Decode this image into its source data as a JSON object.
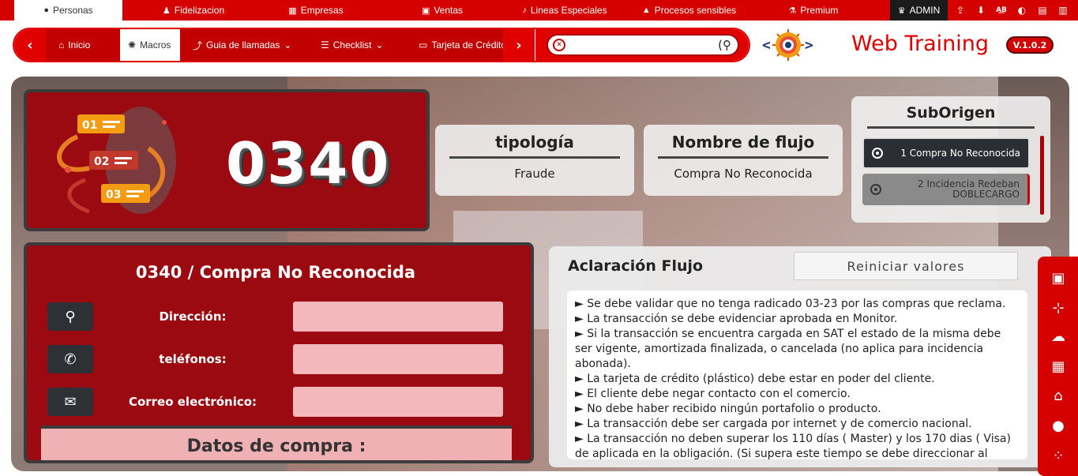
{
  "top_nav": {
    "tabs": [
      {
        "label": "Personas",
        "icon": "person-icon"
      },
      {
        "label": "Fidelizacion",
        "icon": "users-icon"
      },
      {
        "label": "Empresas",
        "icon": "building-icon"
      },
      {
        "label": "Ventas",
        "icon": "money-icon"
      },
      {
        "label": "Lineas Especiales",
        "icon": "microphone-icon"
      },
      {
        "label": "Procesos sensibles",
        "icon": "warning-icon"
      },
      {
        "label": "Premium",
        "icon": "flask-icon"
      }
    ],
    "admin_label": "ADMIN",
    "active_tab": "Personas"
  },
  "sub_nav": {
    "items": [
      {
        "label": "Inicio",
        "icon": "home-icon"
      },
      {
        "label": "Macros",
        "icon": "gear-icon"
      },
      {
        "label": "Guia de llamadas",
        "icon": "route-icon"
      },
      {
        "label": "Checklist",
        "icon": "list-check-icon"
      },
      {
        "label": "Tarjeta de Crédito",
        "icon": "credit-card-icon"
      }
    ],
    "active_item": "Macros",
    "search_placeholder": ""
  },
  "brand": {
    "name": "Web Training",
    "version": "V.1.0.2"
  },
  "code_card": {
    "code": "0340",
    "step_labels": [
      "01",
      "02",
      "03"
    ]
  },
  "tipologia": {
    "title": "tipología",
    "value": "Fraude"
  },
  "nombre_flujo": {
    "title": "Nombre de flujo",
    "value": "Compra No Reconocida"
  },
  "suborigen": {
    "title": "SubOrigen",
    "items": [
      {
        "label": "1 Compra No Reconocida",
        "selected": true
      },
      {
        "label": "2 Incidencia Redeban DOBLECARGO",
        "selected": false
      }
    ]
  },
  "contact": {
    "title": "0340 / Compra No Reconocida",
    "fields": [
      {
        "label": "Dirección:",
        "icon": "location-pin-icon",
        "value": ""
      },
      {
        "label": "teléfonos:",
        "icon": "phone-icon",
        "value": ""
      },
      {
        "label": "Correo electrónico:",
        "icon": "email-icon",
        "value": ""
      }
    ],
    "datos_compra": "Datos de compra :"
  },
  "aclaracion": {
    "title": "Aclaración Flujo",
    "reset_label": "Reiniciar valores",
    "lines": [
      "► Se debe validar que no tenga radicado 03-23 por las compras que reclama.",
      "► La transacción se debe evidenciar aprobada en Monitor.",
      "► Si la transacción se encuentra cargada en SAT el estado de la misma debe ser vigente, amortizada finalizada, o cancelada (no aplica para incidencia abonada).",
      "► La tarjeta de crédito (plástico) debe estar en poder del cliente.",
      "► El cliente debe negar contacto con el comercio.",
      "► No debe haber recibido ningún portafolio o producto.",
      "► La transacción debe ser cargada por internet y de comercio nacional.",
      "► La transacción no deben superar los 110 días ( Master) y los 170 dias ( Visa) de aplicada en la obligación. (Si supera este tiempo se debe direccionar al"
    ]
  },
  "right_sidebar": {
    "icons": [
      "monitor-icon",
      "sitemap-icon",
      "chat-icon",
      "building-icon",
      "bank-icon",
      "apple-icon",
      "shoe-prints-icon"
    ]
  },
  "colors": {
    "primary_red": "#d50000",
    "dark_red_card": "#9b0a10",
    "dark_gray": "#2b2f35"
  }
}
